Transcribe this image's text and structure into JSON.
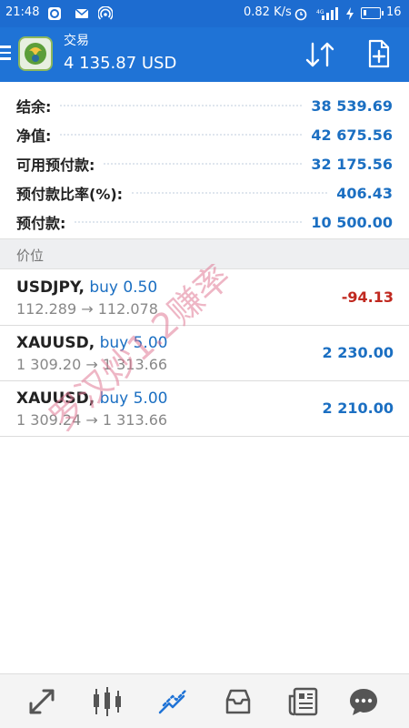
{
  "status_bar": {
    "time": "21:48",
    "net_speed": "0.82 K/s",
    "battery": "16",
    "battery_level": 0.16
  },
  "app_bar": {
    "title": "交易",
    "subtitle": "4 135.87 USD"
  },
  "summary": [
    {
      "label": "结余:",
      "value": "38 539.69"
    },
    {
      "label": "净值:",
      "value": "42 675.56"
    },
    {
      "label": "可用预付款:",
      "value": "32 175.56"
    },
    {
      "label": "预付款比率(%):",
      "value": "406.43"
    },
    {
      "label": "预付款:",
      "value": "10 500.00"
    }
  ],
  "section_header": "价位",
  "positions": [
    {
      "symbol": "USDJPY,",
      "side": "buy 0.50",
      "prices": "112.289 → 112.078",
      "profit": "-94.13",
      "negative": true
    },
    {
      "symbol": "XAUUSD,",
      "side": "buy 5.00",
      "prices": "1 309.20 → 1 313.66",
      "profit": "2 230.00",
      "negative": false
    },
    {
      "symbol": "XAUUSD,",
      "side": "buy 5.00",
      "prices": "1 309.24 → 1 313.66",
      "profit": "2 210.00",
      "negative": false
    }
  ],
  "watermark_text": "罗汉炒1.2赚率",
  "colors": {
    "status_bar": "#1d6cd0",
    "app_bar": "#1f73d6",
    "value_blue": "#1b6fc2",
    "loss_red": "#c0281f",
    "watermark": "#e07a96"
  },
  "bottom_nav": [
    "quotes-icon",
    "chart-icon",
    "trade-icon",
    "history-icon",
    "news-icon",
    "chat-icon"
  ]
}
